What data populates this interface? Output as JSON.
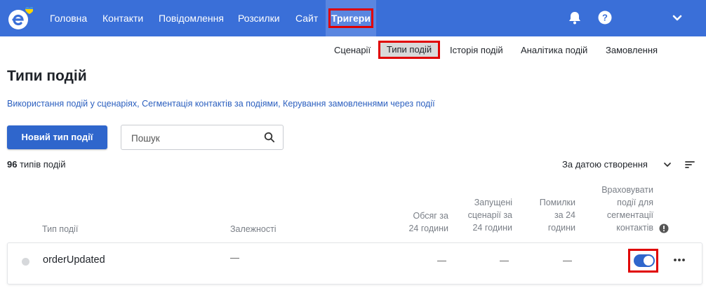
{
  "nav": {
    "items": [
      "Головна",
      "Контакти",
      "Повідомлення",
      "Розсилки",
      "Сайт"
    ],
    "active": "Тригери"
  },
  "icons": {
    "logo": "esputnik-logo",
    "bell": "bell-icon",
    "help": "help-icon",
    "chevron": "chevron-down-icon",
    "search": "search-icon",
    "sort_chevron": "chevron-down-icon",
    "sort_lines": "sort-lines-icon",
    "info": "info-icon",
    "more": "more-dots-icon"
  },
  "colors": {
    "topbar": "#3a6fd8",
    "primary": "#2f66cc",
    "highlight": "#e00000",
    "link": "#2b5fbf"
  },
  "subnav": {
    "items": [
      "Сценарії",
      "Історія подій",
      "Аналітика подій",
      "Замовлення"
    ],
    "active": "Типи подій"
  },
  "page": {
    "title": "Типи подій",
    "links": [
      "Використання подій у сценаріях",
      "Сегментація контактів за подіями",
      "Керування замовленнями через події"
    ],
    "link_separator": ", "
  },
  "toolbar": {
    "new_button": "Новий тип події",
    "search_placeholder": "Пошук"
  },
  "summary": {
    "count": "96",
    "count_label": " типів подій",
    "sort_label": "За датою створення"
  },
  "table": {
    "headers": {
      "type": "Тип події",
      "deps": "Залежності",
      "volume": [
        "Обсяг за",
        "24 години"
      ],
      "scenarios": [
        "Запущені",
        "сценарії за",
        "24 години"
      ],
      "errors": [
        "Помилки",
        "за 24",
        "години"
      ],
      "segmentation": [
        "Враховувати",
        "події для",
        "сегментації",
        "контактів"
      ]
    },
    "rows": [
      {
        "name": "orderUpdated",
        "deps": "—",
        "volume": "—",
        "scenarios": "—",
        "errors": "—",
        "segmentation_enabled": true
      }
    ]
  }
}
